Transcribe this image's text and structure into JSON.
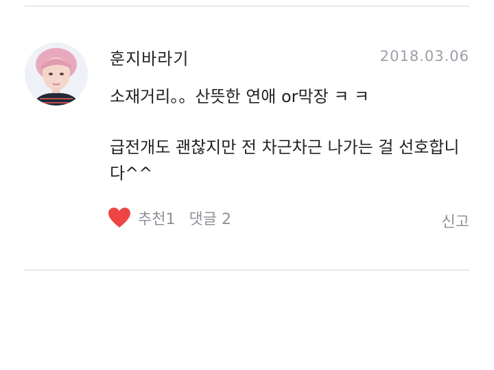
{
  "comment": {
    "author": "훈지바라기",
    "date": "2018.03.06",
    "paragraphs": [
      "소재거리。。산뜻한 연애 or막장 ㅋ ㅋ",
      "급전개도 괜찮지만 전 차근차근 나가는 걸 선호합니다^^"
    ],
    "actions": {
      "like_label": "추천1",
      "comment_label": "댓글 2",
      "report_label": "신고"
    }
  },
  "colors": {
    "heart": "#ef4444",
    "meta_text": "#8d9197",
    "date_text": "#9a9ea6",
    "divider": "#e8e8e8"
  },
  "icons": {
    "like": "heart-icon",
    "avatar": "user-avatar"
  }
}
